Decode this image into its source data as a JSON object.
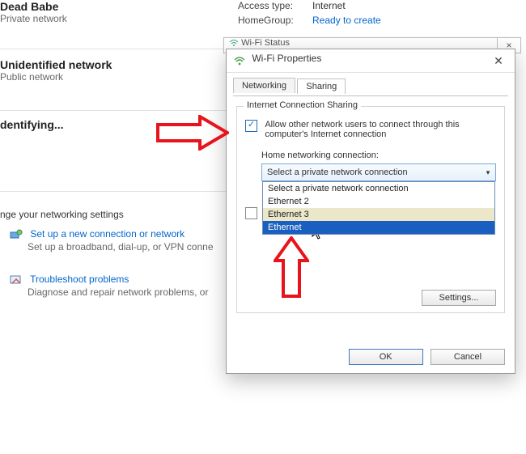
{
  "background": {
    "net1_name": "Dead Babe",
    "net1_type": "Private network",
    "net2_name": "Unidentified network",
    "net2_type": "Public network",
    "net3_name": "dentifying...",
    "access_label": "Access type:",
    "access_value": "Internet",
    "homegroup_label": "HomeGroup:",
    "homegroup_value": "Ready to create",
    "settings_heading": "nge your networking settings",
    "setup_link": "Set up a new connection or network",
    "setup_desc": "Set up a broadband, dial-up, or VPN conne",
    "troubleshoot_link": "Troubleshoot problems",
    "troubleshoot_desc": "Diagnose and repair network problems, or"
  },
  "under_window_title": "Wi-Fi Status",
  "dialog": {
    "title": "Wi-Fi Properties",
    "tab_networking": "Networking",
    "tab_sharing": "Sharing",
    "group_legend": "Internet Connection Sharing",
    "allow_label": "Allow other network users to connect through this computer's Internet connection",
    "home_label": "Home networking connection:",
    "combo_value": "Select a private network connection",
    "options": {
      "o0": "Select a private network connection",
      "o1": "Ethernet 2",
      "o2": "Ethernet 3",
      "o3": "Ethernet"
    },
    "settings_btn": "Settings...",
    "ok": "OK",
    "cancel": "Cancel"
  }
}
